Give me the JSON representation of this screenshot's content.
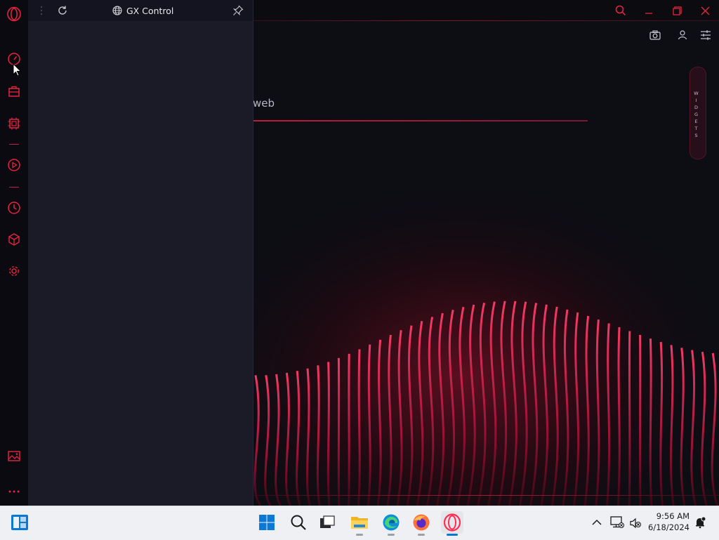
{
  "panel": {
    "title": "GX Control"
  },
  "page": {
    "search_fragment": "web",
    "widgets_label": "WIDGETS"
  },
  "sidebar": {
    "items": [
      {
        "icon": "opera-gx-logo-icon"
      },
      {
        "icon": "speedometer-icon"
      },
      {
        "icon": "gx-briefcase-icon"
      },
      {
        "icon": "cpu-chip-icon"
      },
      {
        "icon": "play-circle-icon"
      },
      {
        "icon": "history-clock-icon"
      },
      {
        "icon": "cube-icon"
      },
      {
        "icon": "gear-icon"
      },
      {
        "icon": "wallpaper-icon"
      },
      {
        "icon": "more-icon"
      }
    ]
  },
  "taskbar": {
    "time": "9:56 AM",
    "date": "6/18/2024",
    "apps": [
      "start-icon",
      "search-icon",
      "task-view-icon",
      "file-explorer-icon",
      "edge-icon",
      "firefox-icon",
      "opera-gx-icon"
    ]
  },
  "colors": {
    "accent": "#e8233f",
    "panel_bg": "#1b1b28",
    "background": "#0d0d14"
  }
}
